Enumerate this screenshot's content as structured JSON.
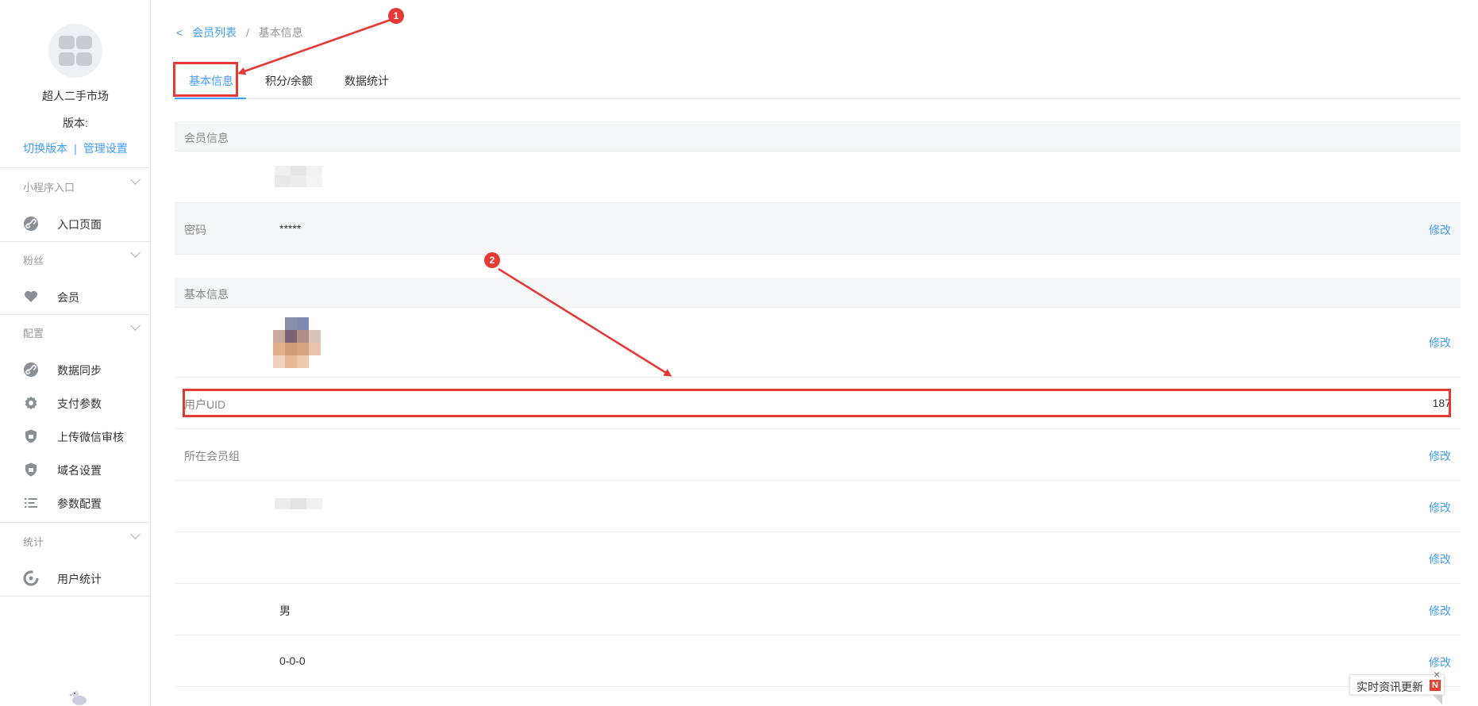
{
  "sidebar": {
    "shop_name": "超人二手市场",
    "version_label": "版本:",
    "switch_version": "切换版本",
    "separator": "|",
    "manage_settings": "管理设置",
    "groups": [
      {
        "title": "小程序入口",
        "items": [
          {
            "label": "入口页面",
            "icon": "link-icon"
          }
        ]
      },
      {
        "title": "粉丝",
        "items": [
          {
            "label": "会员",
            "icon": "heart-icon"
          }
        ]
      },
      {
        "title": "配置",
        "items": [
          {
            "label": "数据同步",
            "icon": "link-icon"
          },
          {
            "label": "支付参数",
            "icon": "gear-icon"
          },
          {
            "label": "上传微信审核",
            "icon": "shield-icon"
          },
          {
            "label": "域名设置",
            "icon": "shield-icon"
          },
          {
            "label": "参数配置",
            "icon": "list-icon"
          }
        ]
      },
      {
        "title": "统计",
        "items": [
          {
            "label": "用户统计",
            "icon": "pie-chart-icon"
          }
        ]
      }
    ]
  },
  "breadcrumb": {
    "back_chevron": "<",
    "parent": "会员列表",
    "separator": "/",
    "current": "基本信息"
  },
  "tabs": [
    {
      "label": "基本信息",
      "active": true
    },
    {
      "label": "积分/余额",
      "active": false
    },
    {
      "label": "数据统计",
      "active": false
    }
  ],
  "sections": {
    "member_info": {
      "title": "会员信息",
      "password_label": "密码",
      "password_value": "*****",
      "edit": "修改"
    },
    "basic_info": {
      "title": "基本信息",
      "uid_label": "用户UID",
      "uid_value": "187",
      "group_label": "所在会员组",
      "gender_value": "男",
      "birthday_value": "0-0-0",
      "edit": "修改"
    }
  },
  "annotations": [
    "1",
    "2"
  ],
  "news_widget": {
    "text": "实时资讯更新",
    "badge": "N",
    "close": "×"
  },
  "colors": {
    "accent": "#409eff",
    "annotation": "#e53935",
    "header_bg": "#f5f6f8"
  }
}
